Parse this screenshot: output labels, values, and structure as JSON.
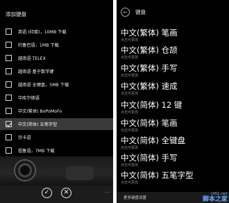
{
  "left": {
    "title": "添加键盘",
    "items": [
      {
        "label": "英语 (印度)，10MB 下载",
        "checked": false,
        "selected": false
      },
      {
        "label": "约鲁巴语，1MB 下载",
        "checked": false,
        "selected": false
      },
      {
        "label": "越南语 TELEX",
        "checked": false,
        "selected": false
      },
      {
        "label": "越南语 基于数字键",
        "checked": false,
        "selected": false
      },
      {
        "label": "越南语 全键盘，5MB 下载",
        "checked": false,
        "selected": false
      },
      {
        "label": "中库尔德语",
        "checked": false,
        "selected": false
      },
      {
        "label": "中文(繁体) BoPoMoFo",
        "checked": false,
        "selected": false
      },
      {
        "label": "中文(简体) 五笔字型",
        "checked": true,
        "selected": true
      },
      {
        "label": "宗卡语",
        "checked": false,
        "selected": false
      },
      {
        "label": "祖鲁语，7MB 下载",
        "checked": false,
        "selected": false
      }
    ],
    "appbar": {
      "done_icon": "✓",
      "cancel_icon": "✕",
      "more": "..."
    }
  },
  "right": {
    "title": "键盘",
    "items": [
      {
        "name": "中文(繁体) 笔画",
        "sub": "点击可更改"
      },
      {
        "name": "中文(繁体) 仓颉",
        "sub": "点击可更改"
      },
      {
        "name": "中文(繁体) 手写",
        "sub": "点击可更改"
      },
      {
        "name": "中文(繁体) 速成",
        "sub": "点击可更改"
      },
      {
        "name": "中文(简体) 12 键",
        "sub": "点击可更改"
      },
      {
        "name": "中文(简体) 笔画",
        "sub": "点击可更改"
      },
      {
        "name": "中文(简体) 全键盘",
        "sub": "点击可更改"
      },
      {
        "name": "中文(简体) 手写",
        "sub": "点击可更改"
      },
      {
        "name": "中文(简体) 五笔字型",
        "sub": "点击可更改"
      }
    ],
    "bottom_label": "更多键盘设置"
  },
  "watermark": {
    "url": "jb51.net",
    "name": "脚本之家"
  }
}
